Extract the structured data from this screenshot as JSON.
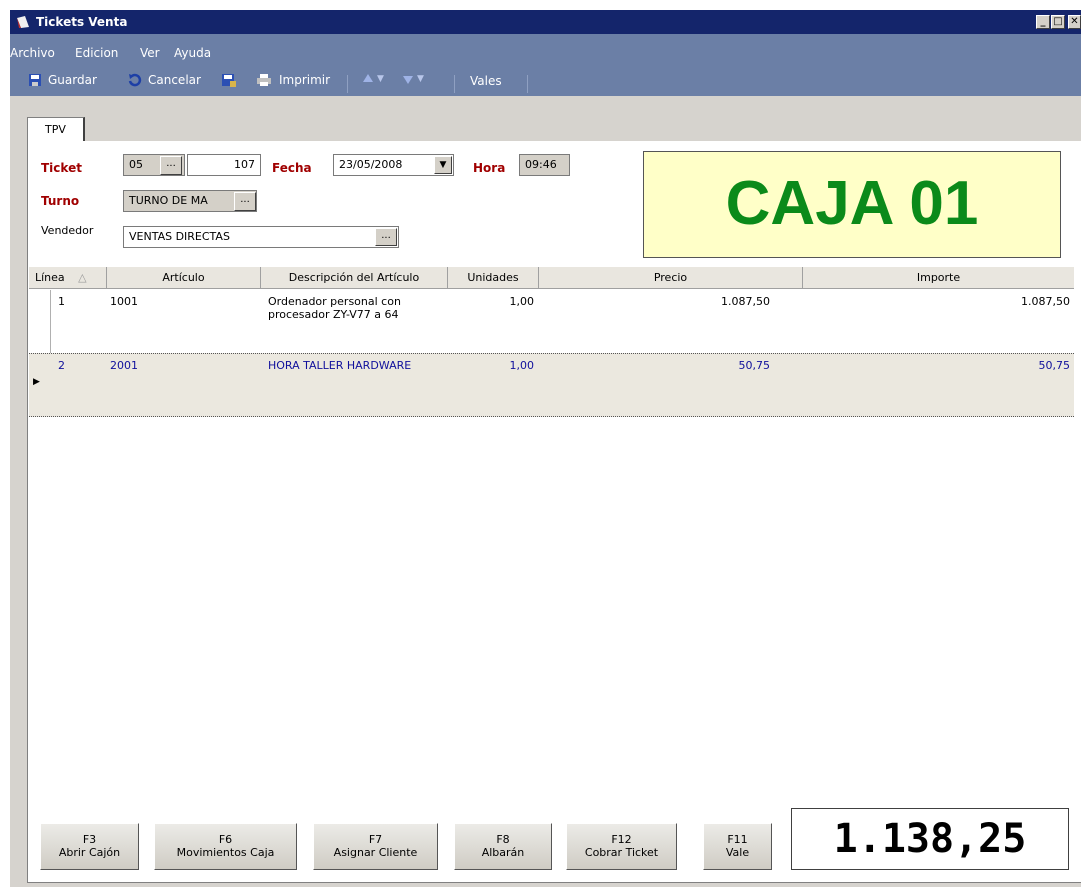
{
  "window": {
    "title": "Tickets Venta",
    "min_glyph": "_",
    "max_glyph": "□",
    "close_glyph": "✕"
  },
  "menu": [
    "Archivo",
    "Edicion",
    "Ver",
    "Ayuda"
  ],
  "toolbar": {
    "save": "Guardar",
    "cancel": "Cancelar",
    "print": "Imprimir",
    "vales": "Vales"
  },
  "tab": "TPV",
  "form": {
    "ticket_label": "Ticket",
    "ticket_series": "05",
    "ticket_number": "107",
    "fecha_label": "Fecha",
    "fecha_value": "23/05/2008",
    "hora_label": "Hora",
    "hora_value": "09:46",
    "turno_label": "Turno",
    "turno_value": "TURNO DE MA",
    "vendedor_label": "Vendedor",
    "vendedor_value": "VENTAS DIRECTAS",
    "ellipsis": "..."
  },
  "caja": "CAJA 01",
  "grid": {
    "columns": [
      "Línea",
      "Artículo",
      "Descripción del Artículo",
      "Unidades",
      "Precio",
      "Importe"
    ],
    "rows": [
      {
        "linea": "1",
        "articulo": "1001",
        "descripcion": "Ordenador personal con\nprocesador ZY-V77 a 64",
        "unidades": "1,00",
        "precio": "1.087,50",
        "importe": "1.087,50"
      },
      {
        "linea": "2",
        "articulo": "2001",
        "descripcion": "HORA TALLER HARDWARE",
        "unidades": "1,00",
        "precio": "50,75",
        "importe": "50,75"
      }
    ]
  },
  "footer": {
    "buttons": [
      {
        "key": "F3",
        "label": "Abrir Cajón"
      },
      {
        "key": "F6",
        "label": "Movimientos Caja"
      },
      {
        "key": "F7",
        "label": "Asignar Cliente"
      },
      {
        "key": "F8",
        "label": "Albarán"
      },
      {
        "key": "F12",
        "label": "Cobrar Ticket"
      },
      {
        "key": "F11",
        "label": "Vale"
      }
    ],
    "total": "1.138,25"
  },
  "colors": {
    "titlebar": "#14256b",
    "menubar": "#6b7fa6",
    "caja_bg": "#ffffc8",
    "caja_text": "#0b8a1a",
    "label_red": "#a00000",
    "selected_text": "#10109c"
  }
}
